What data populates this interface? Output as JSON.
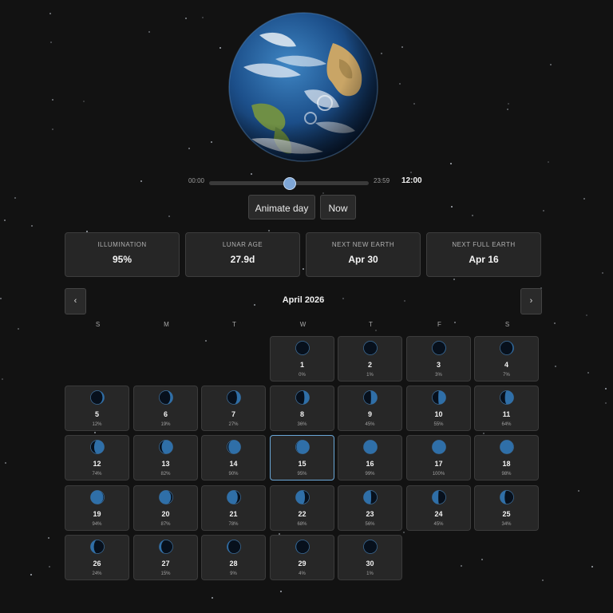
{
  "time_slider": {
    "start_label": "00:00",
    "end_label": "23:59",
    "current_time": "12:00",
    "value_fraction": 0.5
  },
  "buttons": {
    "animate_label": "Animate day",
    "now_label": "Now"
  },
  "stats": [
    {
      "label": "ILLUMINATION",
      "value": "95%"
    },
    {
      "label": "LUNAR AGE",
      "value": "27.9d"
    },
    {
      "label": "NEXT NEW EARTH",
      "value": "Apr 30"
    },
    {
      "label": "NEXT FULL EARTH",
      "value": "Apr 16"
    }
  ],
  "calendar": {
    "title": "April 2026",
    "prev_label": "‹",
    "next_label": "›",
    "weekdays": [
      "S",
      "M",
      "T",
      "W",
      "T",
      "F",
      "S"
    ],
    "first_weekday_index": 3,
    "selected_day": 15,
    "days": [
      {
        "day": "1",
        "pct": "0%"
      },
      {
        "day": "2",
        "pct": "1%"
      },
      {
        "day": "3",
        "pct": "3%"
      },
      {
        "day": "4",
        "pct": "7%"
      },
      {
        "day": "5",
        "pct": "12%"
      },
      {
        "day": "6",
        "pct": "19%"
      },
      {
        "day": "7",
        "pct": "27%"
      },
      {
        "day": "8",
        "pct": "36%"
      },
      {
        "day": "9",
        "pct": "45%"
      },
      {
        "day": "10",
        "pct": "55%"
      },
      {
        "day": "11",
        "pct": "64%"
      },
      {
        "day": "12",
        "pct": "74%"
      },
      {
        "day": "13",
        "pct": "82%"
      },
      {
        "day": "14",
        "pct": "90%"
      },
      {
        "day": "15",
        "pct": "95%"
      },
      {
        "day": "16",
        "pct": "99%"
      },
      {
        "day": "17",
        "pct": "100%"
      },
      {
        "day": "18",
        "pct": "98%"
      },
      {
        "day": "19",
        "pct": "94%"
      },
      {
        "day": "20",
        "pct": "87%"
      },
      {
        "day": "21",
        "pct": "78%"
      },
      {
        "day": "22",
        "pct": "68%"
      },
      {
        "day": "23",
        "pct": "56%"
      },
      {
        "day": "24",
        "pct": "45%"
      },
      {
        "day": "25",
        "pct": "34%"
      },
      {
        "day": "26",
        "pct": "24%"
      },
      {
        "day": "27",
        "pct": "15%"
      },
      {
        "day": "28",
        "pct": "9%"
      },
      {
        "day": "29",
        "pct": "4%"
      },
      {
        "day": "30",
        "pct": "1%"
      }
    ]
  },
  "colors": {
    "background": "#121212",
    "accent": "#6aa6d6",
    "phase_lit": "#2f6fa8",
    "phase_dark": "#07101c"
  },
  "icons": {
    "globe": "earth-globe-icon",
    "phase": "earth-phase-icon",
    "prev": "chevron-left-icon",
    "next": "chevron-right-icon"
  }
}
